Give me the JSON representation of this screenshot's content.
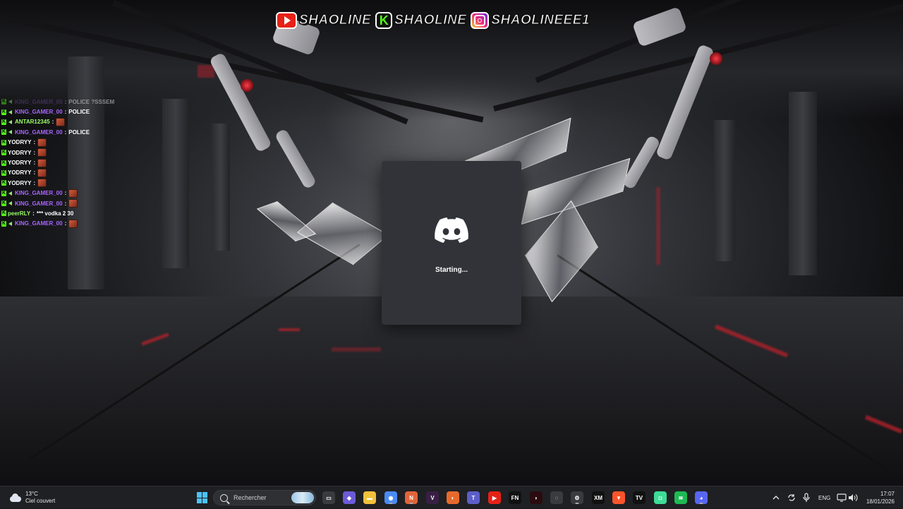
{
  "overlay": {
    "socials": [
      {
        "platform": "youtube",
        "icon": "youtube-icon",
        "handle": "SHAOLINE"
      },
      {
        "platform": "kick",
        "icon": "kick-icon",
        "handle": "SHAOLINE"
      },
      {
        "platform": "instagram",
        "icon": "instagram-icon",
        "handle": "SHAOLINEEE1"
      }
    ],
    "chat": [
      {
        "user": "KING_GAMER_00",
        "user_color": "#6d4a9a",
        "message": "POLICE ?SSSEM",
        "emote": false,
        "arrow": true,
        "faded": true
      },
      {
        "user": "KING_GAMER_00",
        "user_color": "#a866ff",
        "message": "POLICE",
        "emote": false,
        "arrow": true,
        "faded": false
      },
      {
        "user": "ANTAR12345",
        "user_color": "#9cff6a",
        "message": "",
        "emote": true,
        "arrow": true,
        "faded": false
      },
      {
        "user": "KING_GAMER_00",
        "user_color": "#a866ff",
        "message": "POLICE",
        "emote": false,
        "arrow": true,
        "faded": false
      },
      {
        "user": "YODRYY",
        "user_color": "#ffffff",
        "message": "",
        "emote": true,
        "arrow": false,
        "faded": false
      },
      {
        "user": "YODRYY",
        "user_color": "#ffffff",
        "message": "",
        "emote": true,
        "arrow": false,
        "faded": false
      },
      {
        "user": "YODRYY",
        "user_color": "#ffffff",
        "message": "",
        "emote": true,
        "arrow": false,
        "faded": false
      },
      {
        "user": "YODRYY",
        "user_color": "#ffffff",
        "message": "",
        "emote": true,
        "arrow": false,
        "faded": false
      },
      {
        "user": "YODRYY",
        "user_color": "#ffffff",
        "message": "",
        "emote": true,
        "arrow": false,
        "faded": false
      },
      {
        "user": "KING_GAMER_00",
        "user_color": "#a866ff",
        "message": "",
        "emote": true,
        "arrow": true,
        "faded": false
      },
      {
        "user": "KING_GAMER_00",
        "user_color": "#a866ff",
        "message": "",
        "emote": true,
        "arrow": true,
        "faded": false
      },
      {
        "user": "peerRLY",
        "user_color": "#9cff6a",
        "message": "*** vodka 2 30",
        "emote": false,
        "arrow": false,
        "faded": false
      },
      {
        "user": "KING_GAMER_00",
        "user_color": "#a866ff",
        "message": "",
        "emote": true,
        "arrow": true,
        "faded": false
      }
    ]
  },
  "discord_splash": {
    "icon": "discord-logo-icon",
    "status": "Starting...",
    "bg_color": "#313338",
    "logo_color": "#ffffff"
  },
  "taskbar": {
    "weather": {
      "icon": "cloud-icon",
      "temperature": "13°C",
      "description": "Ciel couvert"
    },
    "start_icon": "windows-start-icon",
    "search": {
      "placeholder": "Rechercher",
      "icon": "search-icon"
    },
    "apps": [
      {
        "name": "task-view",
        "icon": "task-view-icon",
        "color": "#3a3b3f",
        "glyph": "▭",
        "running": false
      },
      {
        "name": "copilot",
        "icon": "copilot-icon",
        "color": "#6b5bd6",
        "glyph": "◆",
        "running": false
      },
      {
        "name": "file-explorer",
        "icon": "folder-icon",
        "color": "#f3c13a",
        "glyph": "▬",
        "running": false
      },
      {
        "name": "chrome",
        "icon": "chrome-icon",
        "color": "#4a8af4",
        "glyph": "◉",
        "running": true
      },
      {
        "name": "streamlabs",
        "icon": "streamlabs-icon",
        "color": "#e0643a",
        "glyph": "N",
        "running": true
      },
      {
        "name": "vegas",
        "icon": "vegas-icon",
        "color": "#3a1f44",
        "glyph": "V",
        "running": false
      },
      {
        "name": "firefox",
        "icon": "firefox-icon",
        "color": "#e66a2c",
        "glyph": "◐",
        "running": false
      },
      {
        "name": "teams",
        "icon": "teams-icon",
        "color": "#5b5fc7",
        "glyph": "T",
        "running": false
      },
      {
        "name": "youtube",
        "icon": "youtube-app-icon",
        "color": "#e62117",
        "glyph": "▶",
        "running": false
      },
      {
        "name": "fn",
        "icon": "fn-icon",
        "color": "#111111",
        "glyph": "FN",
        "running": false
      },
      {
        "name": "red-app",
        "icon": "red-bull-icon",
        "color": "#2a0c10",
        "glyph": "◗",
        "running": false
      },
      {
        "name": "app-outline",
        "icon": "shell-icon",
        "color": "#3a3b3f",
        "glyph": "◌",
        "running": false
      },
      {
        "name": "steam",
        "icon": "steam-icon",
        "color": "#3a3b3f",
        "glyph": "⚙",
        "running": true
      },
      {
        "name": "xm",
        "icon": "xm-icon",
        "color": "#111111",
        "glyph": "XM",
        "running": false
      },
      {
        "name": "brave",
        "icon": "brave-icon",
        "color": "#fb542b",
        "glyph": "▼",
        "running": false
      },
      {
        "name": "tradingview",
        "icon": "tradingview-icon",
        "color": "#111111",
        "glyph": "TV",
        "running": false
      },
      {
        "name": "android-app",
        "icon": "android-icon",
        "color": "#3ddc97",
        "glyph": "◘",
        "running": false
      },
      {
        "name": "spotify",
        "icon": "spotify-icon",
        "color": "#1db954",
        "glyph": "≋",
        "running": false
      },
      {
        "name": "discord",
        "icon": "discord-icon",
        "color": "#5865f2",
        "glyph": "◕",
        "running": true
      }
    ],
    "tray": {
      "chevron_icon": "chevron-up-icon",
      "sync_icon": "sync-icon",
      "mic_icon": "microphone-icon",
      "language": "ENG",
      "display_icon": "display-icon",
      "volume_icon": "volume-icon"
    },
    "clock": {
      "time": "17:07",
      "date": "18/01/2026"
    }
  }
}
